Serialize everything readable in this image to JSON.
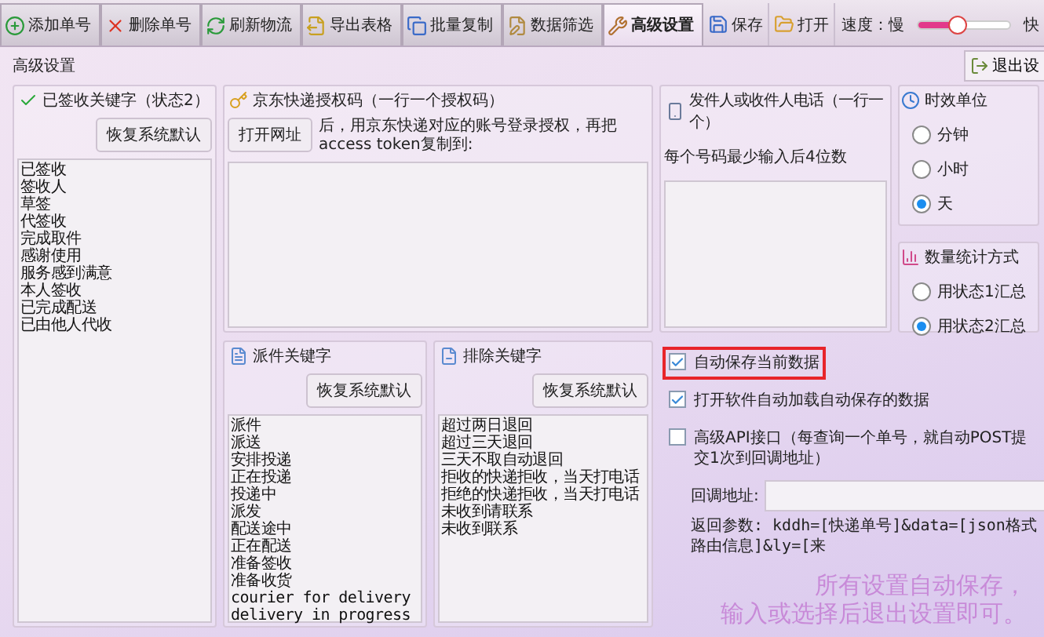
{
  "toolbar": {
    "tabs": [
      {
        "label": "添加单号",
        "selected": false
      },
      {
        "label": "删除单号",
        "selected": false
      },
      {
        "label": "刷新物流",
        "selected": false
      },
      {
        "label": "导出表格",
        "selected": false
      },
      {
        "label": "批量复制",
        "selected": false
      },
      {
        "label": "数据筛选",
        "selected": false
      },
      {
        "label": "高级设置",
        "selected": true
      }
    ],
    "actions": [
      "保存",
      "打开"
    ],
    "speed": {
      "label": "速度：慢",
      "max_label": "快",
      "level": 0.43
    }
  },
  "header": {
    "title": "高级设置",
    "exit_button": "退出设"
  },
  "signed_group": {
    "title": "已签收关键字（状态2）",
    "reset_button": "恢复系统默认",
    "keywords": [
      "已签收",
      "签收人",
      "草签",
      "代签收",
      "完成取件",
      "感谢使用",
      "服务感到满意",
      "本人签收",
      "已完成配送",
      "已由他人代收"
    ]
  },
  "jd_group": {
    "title": "京东快递授权码（一行一个授权码）",
    "open_button": "打开网址",
    "hint": "后，用京东快递对应的账号登录授权，再把access token复制到:"
  },
  "phone_group": {
    "title": "发件人或收件人电话（一行一个）",
    "hint": "每个号码最少输入后4位数"
  },
  "time_unit": {
    "title": "时效单位",
    "options": [
      {
        "label": "分钟",
        "selected": false
      },
      {
        "label": "小时",
        "selected": false
      },
      {
        "label": "天",
        "selected": true
      }
    ]
  },
  "count_mode": {
    "title": "数量统计方式",
    "options": [
      {
        "label": "用状态1汇总",
        "selected": false
      },
      {
        "label": "用状态2汇总",
        "selected": true
      }
    ]
  },
  "dispatch_group": {
    "title": "派件关键字",
    "reset_button": "恢复系统默认",
    "keywords": [
      "派件",
      "派送",
      "安排投递",
      "正在投递",
      "投递中",
      "派发",
      "配送途中",
      "正在配送",
      "准备签收",
      "准备收货",
      "courier for delivery",
      "delivery in progress"
    ]
  },
  "exclude_group": {
    "title": "排除关键字",
    "reset_button": "恢复系统默认",
    "keywords": [
      "超过两日退回",
      "超过三天退回",
      "三天不取自动退回",
      "拒收的快递拒收，当天打电话",
      "拒绝的快递拒收，当天打电话",
      "未收到请联系",
      "未收到联系"
    ]
  },
  "options": [
    {
      "label": "自动保存当前数据",
      "checked": true,
      "highlighted": true
    },
    {
      "label": "打开软件自动加载自动保存的数据",
      "checked": true,
      "highlighted": false
    },
    {
      "label": "高级API接口（每查询一个单号，就自动POST提交1次到回调地址）",
      "checked": false,
      "highlighted": false
    }
  ],
  "callback": {
    "label": "回调地址:"
  },
  "return_params": "返回参数: kddh=[快递单号]&data=[json格式路由信息]&ly=[来",
  "notice": [
    "所有设置自动保存，",
    "输入或选择后退出设置即可。"
  ]
}
